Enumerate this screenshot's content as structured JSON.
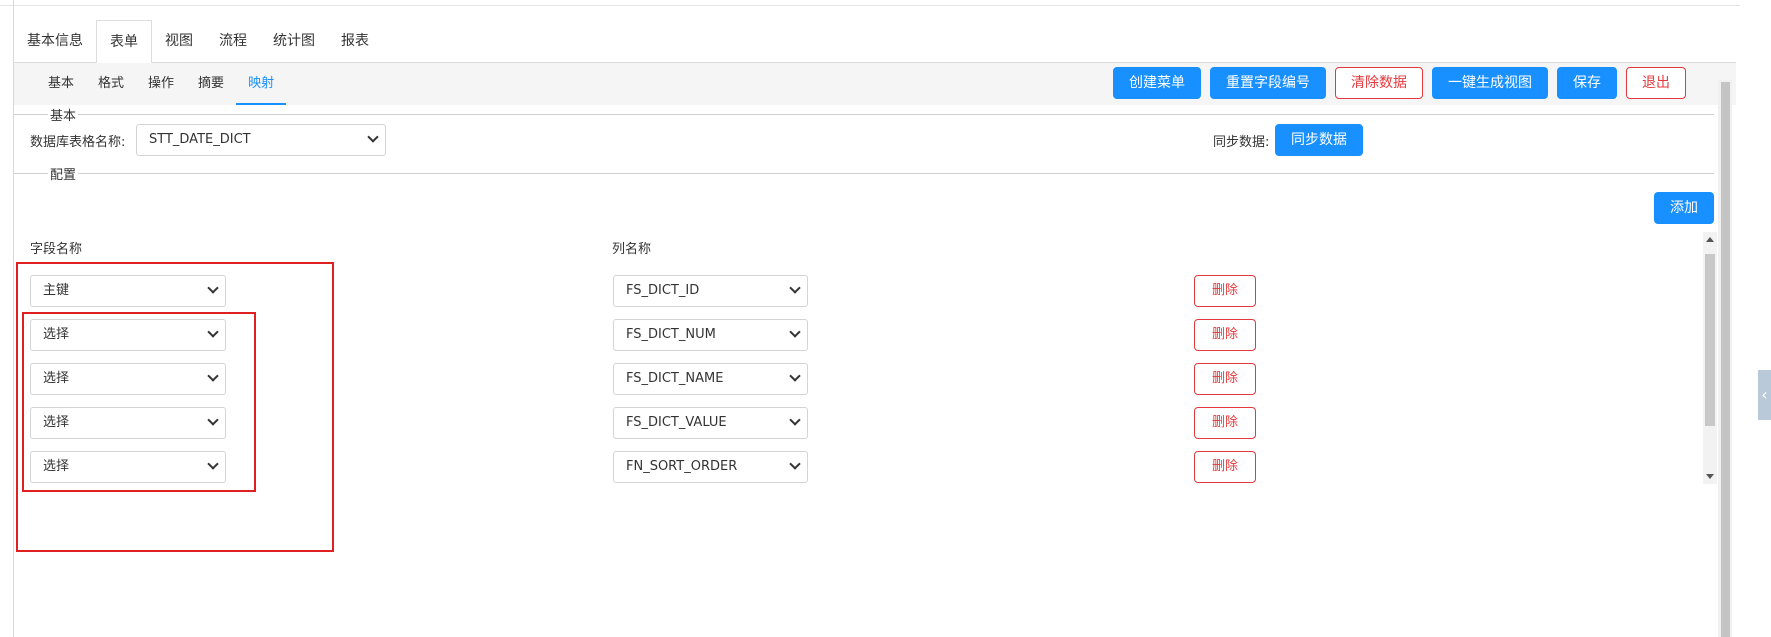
{
  "main_tabs": [
    {
      "label": "基本信息",
      "active": false
    },
    {
      "label": "表单",
      "active": true
    },
    {
      "label": "视图",
      "active": false
    },
    {
      "label": "流程",
      "active": false
    },
    {
      "label": "统计图",
      "active": false
    },
    {
      "label": "报表",
      "active": false
    }
  ],
  "sub_tabs": [
    {
      "label": "基本",
      "active": false
    },
    {
      "label": "格式",
      "active": false
    },
    {
      "label": "操作",
      "active": false
    },
    {
      "label": "摘要",
      "active": false
    },
    {
      "label": "映射",
      "active": true
    }
  ],
  "toolbar": {
    "create_menu": "创建菜单",
    "reset_field_number": "重置字段编号",
    "clear_data": "清除数据",
    "generate_view": "一键生成视图",
    "save": "保存",
    "exit": "退出"
  },
  "basic_section": {
    "legend": "基本",
    "db_table_label": "数据库表格名称:",
    "db_table_value": "STT_DATE_DICT",
    "sync_label": "同步数据:",
    "sync_button": "同步数据"
  },
  "config_section": {
    "legend": "配置",
    "add_button": "添加",
    "field_name_header": "字段名称",
    "column_name_header": "列名称",
    "delete_label": "删除",
    "rows": [
      {
        "field": "主键",
        "column": "FS_DICT_ID"
      },
      {
        "field": "选择",
        "column": "FS_DICT_NUM"
      },
      {
        "field": "选择",
        "column": "FS_DICT_NAME"
      },
      {
        "field": "选择",
        "column": "FS_DICT_VALUE"
      },
      {
        "field": "选择",
        "column": "FN_SORT_ORDER"
      }
    ]
  },
  "colors": {
    "primary": "#1890ff",
    "danger": "#e4393c",
    "highlight_box": "#e02020"
  }
}
